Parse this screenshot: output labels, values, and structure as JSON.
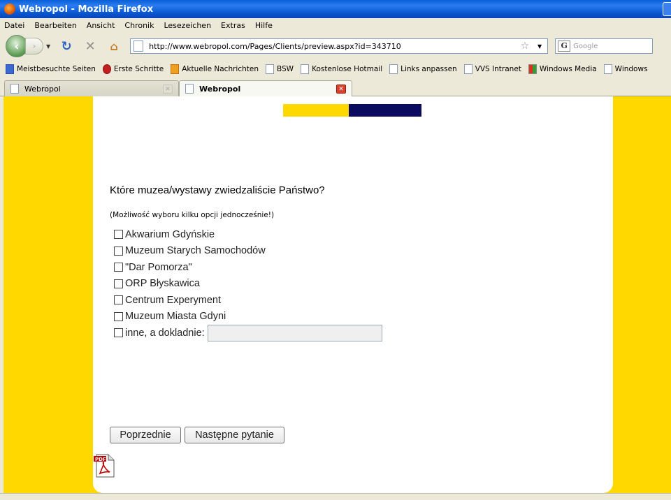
{
  "window": {
    "title": "Webropol - Mozilla Firefox"
  },
  "menu": [
    "Datei",
    "Bearbeiten",
    "Ansicht",
    "Chronik",
    "Lesezeichen",
    "Extras",
    "Hilfe"
  ],
  "navbar": {
    "url": "http://www.webropol.com/Pages/Clients/preview.aspx?id=343710",
    "search_placeholder": "Google"
  },
  "bookmarks": [
    {
      "label": "Meistbesuchte Seiten",
      "icon": "most-visited-icon"
    },
    {
      "label": "Erste Schritte",
      "icon": "firefox-icon"
    },
    {
      "label": "Aktuelle Nachrichten",
      "icon": "rss-icon"
    },
    {
      "label": "BSW",
      "icon": "page-icon"
    },
    {
      "label": "Kostenlose Hotmail",
      "icon": "page-icon"
    },
    {
      "label": "Links anpassen",
      "icon": "page-icon"
    },
    {
      "label": "VVS Intranet",
      "icon": "page-icon"
    },
    {
      "label": "Windows Media",
      "icon": "windows-media-icon"
    },
    {
      "label": "Windows",
      "icon": "page-icon"
    }
  ],
  "tabs": [
    {
      "label": "Webropol",
      "active": false
    },
    {
      "label": "Webropol",
      "active": true
    }
  ],
  "survey": {
    "question": "Które muzea/wystawy zwiedzaliście Państwo?",
    "hint": "(Możliwość wyboru kilku opcji jednocześnie!)",
    "options": [
      "Akwarium Gdyńskie",
      "Muzeum Starych Samochodów",
      "\"Dar Pomorza\"",
      "ORP Błyskawica",
      "Centrum Experyment",
      "Muzeum Miasta Gdyni",
      "inne, a dokladnie:"
    ],
    "other_value": "",
    "prev_label": "Poprzednie",
    "next_label": "Następne pytanie"
  },
  "colors": {
    "page_background": "#ffd800",
    "logo_yellow": "#ffd800",
    "logo_navy": "#0a0a60",
    "titlebar_blue": "#0a5fd8"
  }
}
